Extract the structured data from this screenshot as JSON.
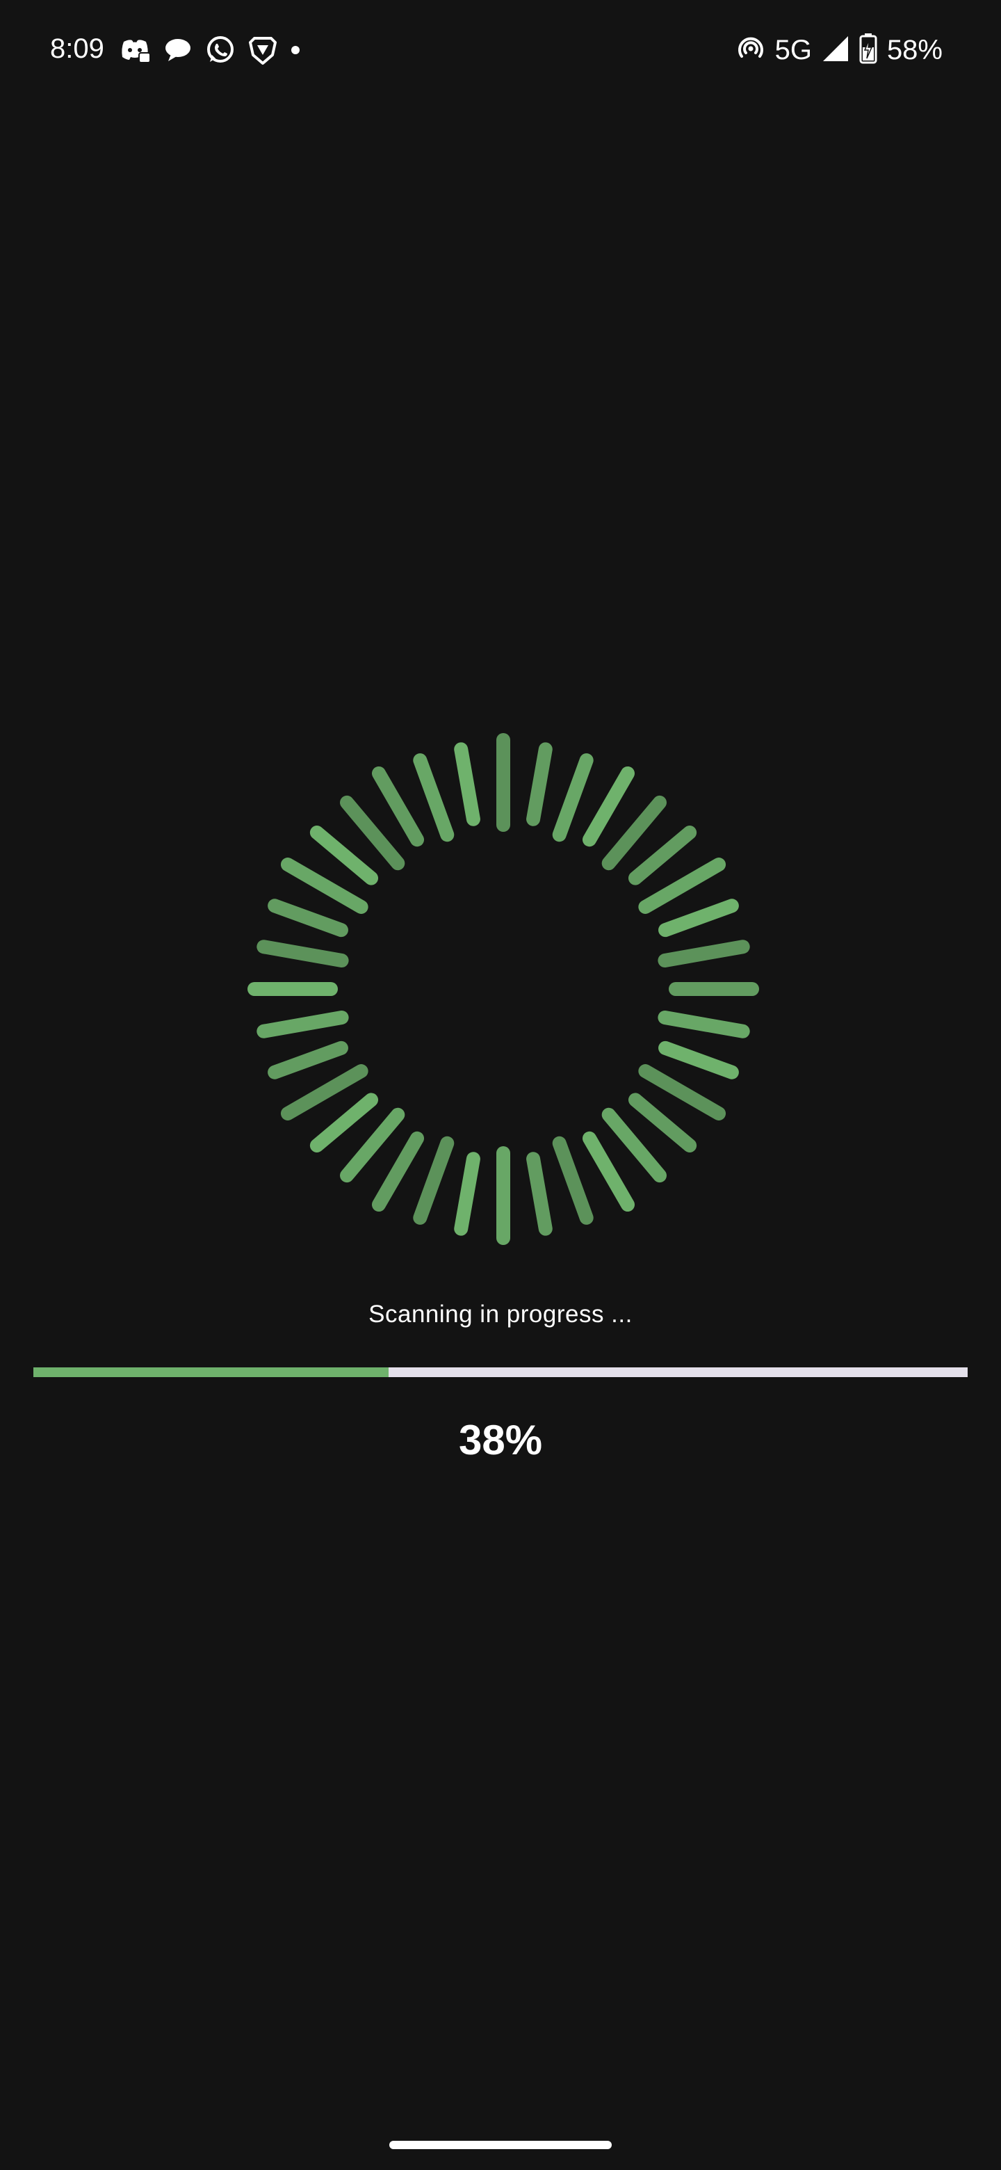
{
  "status_bar": {
    "time": "8:09",
    "network": "5G",
    "battery": "58%",
    "notification_icons": [
      "discord-icon",
      "chat-bubble-icon",
      "whatsapp-icon",
      "brave-icon",
      "dot-icon"
    ],
    "system_icons": [
      "hotspot-icon",
      "signal-icon",
      "battery-charging-icon"
    ]
  },
  "scan": {
    "status_text": "Scanning in progress ...",
    "progress_fraction": 0.38,
    "percent_label": "38%"
  },
  "colors": {
    "background": "#131313",
    "accent": "#6fb26c",
    "track": "#e4e0ea"
  }
}
